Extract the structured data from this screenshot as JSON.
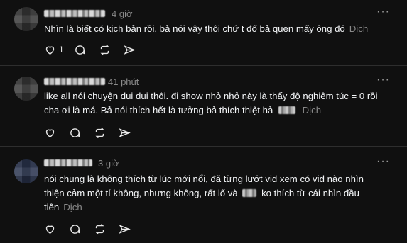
{
  "comments": [
    {
      "time": "4 giờ",
      "text": "Nhìn là biết có kịch bản rồi, bả nói vậy thôi chứ t đố bả quen mấy ông đó",
      "translate": "Dịch",
      "like_count": "1"
    },
    {
      "time": "41 phút",
      "text_line1": "like all nói chuyện dui dui thôi. đi show nhỏ nhỏ này là thấy độ nghiêm túc = 0 rồi",
      "text_line2": "cha ơi là má. Bả nói thích hết là tưởng bả thích thiệt hả",
      "translate": "Dịch"
    },
    {
      "time": "3 giờ",
      "text_line1": "nói chung là không thích từ lúc mới nổi, đã từng lướt vid xem có vid nào nhìn",
      "text_line2_a": "thiện cảm một tí không, nhưng không, rất lố và",
      "text_line2_b": "ko thích từ cái nhìn đầu",
      "text_line3": "tiên",
      "translate": "Dịch"
    }
  ],
  "more_label": "···",
  "icons": [
    "heart-icon",
    "comment-icon",
    "repost-icon",
    "share-icon",
    "more-icon"
  ]
}
